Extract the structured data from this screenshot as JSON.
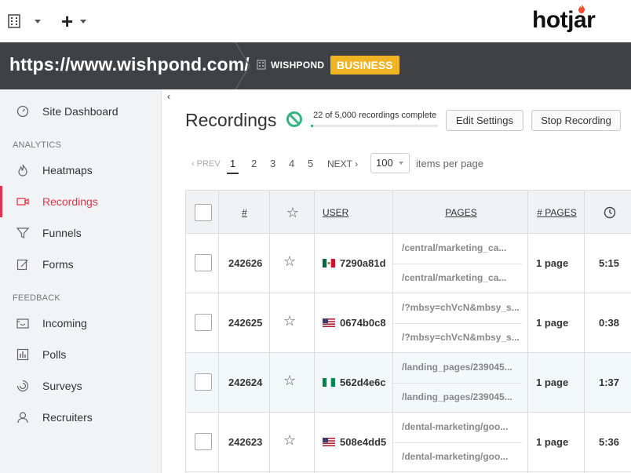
{
  "topbar": {
    "logo": "hotjar"
  },
  "header": {
    "site_url": "https://www.wishpond.com/",
    "org_name": "WISHPOND",
    "plan_badge": "BUSINESS"
  },
  "sidebar": {
    "collapse_glyph": "‹",
    "top_items": [
      {
        "label": "Site Dashboard",
        "icon": "dashboard-icon"
      }
    ],
    "sections": [
      {
        "title": "ANALYTICS",
        "items": [
          {
            "label": "Heatmaps",
            "icon": "flame-icon"
          },
          {
            "label": "Recordings",
            "icon": "camera-icon",
            "active": true
          },
          {
            "label": "Funnels",
            "icon": "funnel-icon"
          },
          {
            "label": "Forms",
            "icon": "form-icon"
          }
        ]
      },
      {
        "title": "FEEDBACK",
        "items": [
          {
            "label": "Incoming",
            "icon": "incoming-icon"
          },
          {
            "label": "Polls",
            "icon": "poll-icon"
          },
          {
            "label": "Surveys",
            "icon": "survey-icon"
          },
          {
            "label": "Recruiters",
            "icon": "recruiter-icon"
          }
        ]
      }
    ]
  },
  "main": {
    "title": "Recordings",
    "progress": {
      "text": "22 of 5,000 recordings complete",
      "completed": 22,
      "total": 5000
    },
    "edit_settings": "Edit Settings",
    "stop_recording": "Stop Recording",
    "pagination": {
      "prev": "‹ PREV",
      "pages": [
        "1",
        "2",
        "3",
        "4",
        "5"
      ],
      "current": "1",
      "next": "NEXT ›"
    },
    "per_page": {
      "value": "100",
      "label": "items per page"
    }
  },
  "table": {
    "headers": {
      "id": "#",
      "user": "USER",
      "pages": "PAGES",
      "num_pages": "# PAGES"
    },
    "rows": [
      {
        "id": "242626",
        "flag": "mexico",
        "user": "7290a81d",
        "pages": [
          "/central/marketing_ca...",
          "/central/marketing_ca..."
        ],
        "num_pages": "1 page",
        "duration": "5:15"
      },
      {
        "id": "242625",
        "flag": "usa",
        "user": "0674b0c8",
        "pages": [
          "/?mbsy=chVcN&mbsy_s...",
          "/?mbsy=chVcN&mbsy_s..."
        ],
        "num_pages": "1 page",
        "duration": "0:38"
      },
      {
        "id": "242624",
        "flag": "nigeria",
        "user": "562d4e6c",
        "pages": [
          "/landing_pages/239045...",
          "/landing_pages/239045..."
        ],
        "num_pages": "1 page",
        "duration": "1:37",
        "highlighted": true
      },
      {
        "id": "242623",
        "flag": "usa",
        "user": "508e4dd5",
        "pages": [
          "/dental-marketing/goo...",
          "/dental-marketing/goo..."
        ],
        "num_pages": "1 page",
        "duration": "5:36"
      }
    ]
  },
  "colors": {
    "accent": "#e2334c",
    "header_bg": "#3f4245",
    "badge": "#f0b323",
    "progress": "#36b37e"
  }
}
